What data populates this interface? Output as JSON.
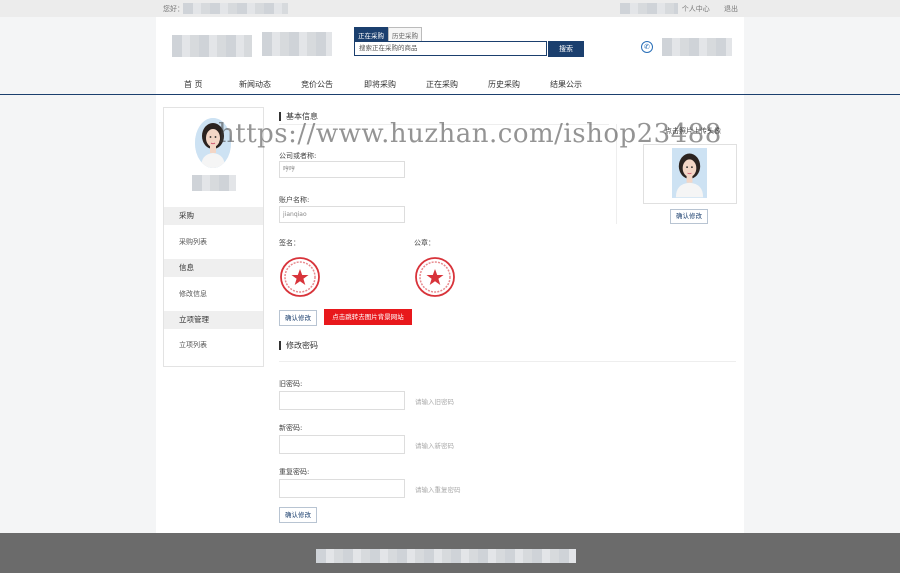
{
  "topbar": {
    "greeting": "您好：",
    "links": [
      "个人中心",
      "退出"
    ]
  },
  "search": {
    "tabs": [
      "正在采购",
      "历史采购"
    ],
    "active_tab": 0,
    "value": "搜索正在采购的商品",
    "button": "搜索"
  },
  "nav": [
    "首 页",
    "新闻动态",
    "竞价公告",
    "即将采购",
    "正在采购",
    "历史采购",
    "结果公示"
  ],
  "sidebar": {
    "sections": [
      {
        "title": "采购",
        "items": [
          "采购列表"
        ]
      },
      {
        "title": "信息",
        "items": [
          "修改信息"
        ]
      },
      {
        "title": "立项管理",
        "items": [
          "立项列表"
        ]
      }
    ]
  },
  "basic": {
    "title": "基本信息",
    "company_label": "公司或者称:",
    "company_value": "哼哼",
    "account_label": "账户名称:",
    "account_value": "jianqiao",
    "signature_label": "签名：",
    "seal_label": "公章：",
    "confirm": "确认修改",
    "red_button": "点击跳转去图片背景网站"
  },
  "avatar_upload": {
    "label": "点击照片上传头像",
    "confirm": "确认修改"
  },
  "password": {
    "title": "修改密码",
    "old_label": "旧密码:",
    "old_hint": "请输入旧密码",
    "new_label": "新密码:",
    "new_hint": "请输入新密码",
    "repeat_label": "重复密码:",
    "repeat_hint": "请输入重复密码",
    "confirm": "确认修改"
  },
  "watermark": "https://www.huzhan.com/ishop23488",
  "colors": {
    "brand": "#1b3f6e",
    "red": "#e8181c",
    "footer": "#6b6b6b"
  }
}
